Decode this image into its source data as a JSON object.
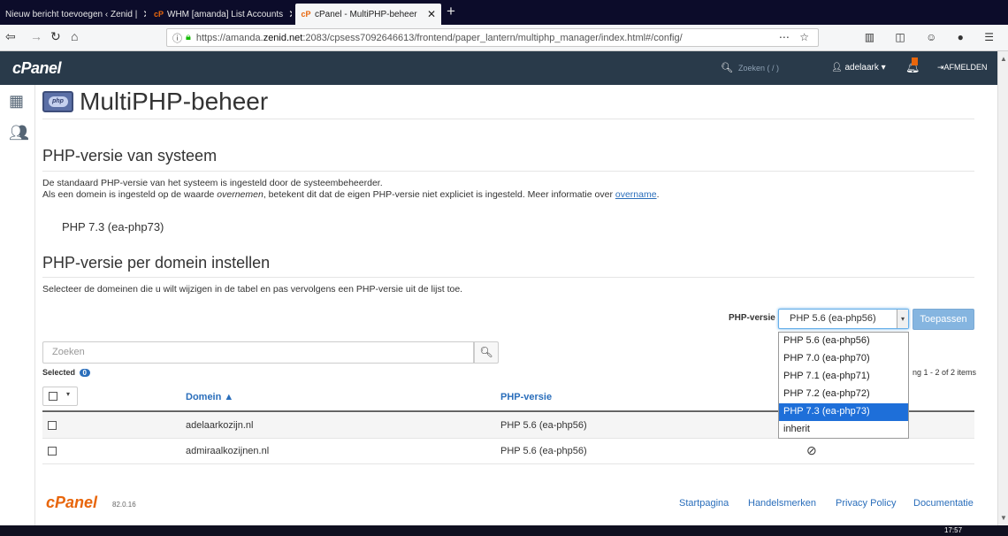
{
  "browser": {
    "tabs": [
      {
        "title": "Nieuw bericht toevoegen ‹ Zenid |",
        "icon": "wordpress-icon"
      },
      {
        "title": "WHM [amanda] List Accounts",
        "icon": "cpanel-icon"
      },
      {
        "title": "cPanel - MultiPHP-beheer",
        "icon": "cpanel-icon"
      }
    ],
    "url_prefix": "https://amanda.",
    "url_host": "zenid.net",
    "url_rest": ":2083/cpsess7092646613/frontend/paper_lantern/multiphp_manager/index.html#/config/"
  },
  "header": {
    "logo": "cPanel",
    "search_placeholder": "Zoeken ( / )",
    "user": "adelaark",
    "logout": "AFMELDEN"
  },
  "page": {
    "title": "MultiPHP-beheer",
    "icon_text": "php"
  },
  "system": {
    "heading": "PHP-versie van systeem",
    "desc1": "De standaard PHP-versie van het systeem is ingesteld door de systeembeheerder.",
    "desc2_a": "Als een domein is ingesteld op de waarde ",
    "desc2_em": "overnemen",
    "desc2_b": ", betekent dit dat de eigen PHP-versie niet expliciet is ingesteld. Meer informatie over ",
    "desc2_link": "overname",
    "desc2_end": ".",
    "version": "PHP 7.3 (ea-php73)"
  },
  "domain_section": {
    "heading": "PHP-versie per domein instellen",
    "desc": "Selecteer de domeinen die u wilt wijzigen in de tabel en pas vervolgens een PHP-versie uit de lijst toe.",
    "php_label": "PHP-versie",
    "selected_value": "PHP 5.6 (ea-php56)",
    "apply_label": "Toepassen",
    "options": [
      "PHP 5.6 (ea-php56)",
      "PHP 7.0 (ea-php70)",
      "PHP 7.1 (ea-php71)",
      "PHP 7.2 (ea-php72)",
      "PHP 7.3 (ea-php73)",
      "inherit"
    ],
    "highlighted_option": "PHP 7.3 (ea-php73)",
    "search_placeholder": "Zoeken",
    "selected_label": "Selected",
    "selected_count": "0",
    "paging": "ng 1 - 2 of 2 items"
  },
  "table": {
    "columns": [
      "Domein ▲",
      "PHP-versie"
    ],
    "rows": [
      {
        "domain": "adelaarkozijn.nl",
        "version": "PHP 5.6 (ea-php56)"
      },
      {
        "domain": "admiraalkozijnen.nl",
        "version": "PHP 5.6 (ea-php56)"
      }
    ]
  },
  "footer": {
    "logo": "cPanel",
    "version": "82.0.16",
    "links": [
      "Startpagina",
      "Handelsmerken",
      "Privacy Policy",
      "Documentatie"
    ]
  },
  "taskbar": {
    "time": "17:57"
  },
  "colors": {
    "header_bg": "#293a4a",
    "accent": "#2a6ebb",
    "brand_orange": "#e8660c",
    "selected_option": "#1e6fd9"
  }
}
